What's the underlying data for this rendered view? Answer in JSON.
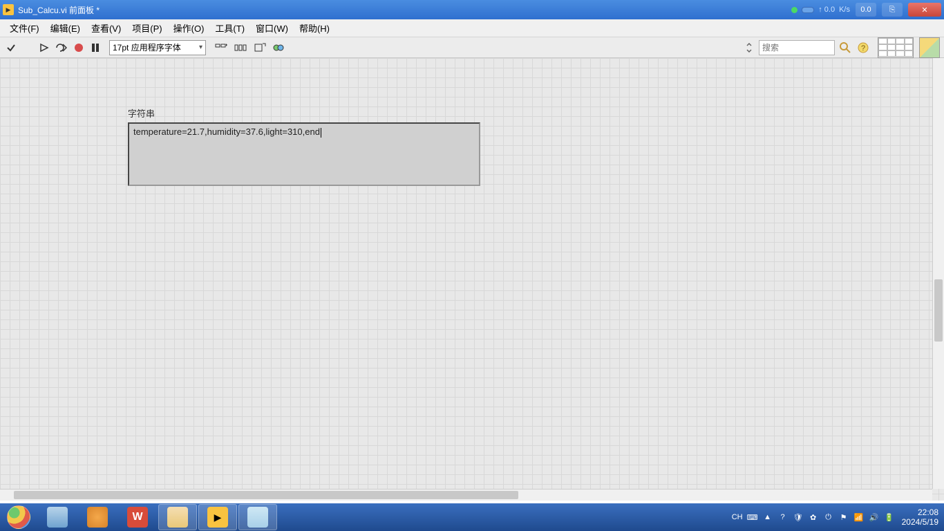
{
  "titlebar": {
    "title": "Sub_Calcu.vi 前面板 *",
    "net_up": "↑ 0.0",
    "net_unit": "K/s",
    "net_mem": "0.0"
  },
  "menubar": {
    "items": [
      "文件(F)",
      "编辑(E)",
      "查看(V)",
      "项目(P)",
      "操作(O)",
      "工具(T)",
      "窗口(W)",
      "帮助(H)"
    ]
  },
  "toolbar": {
    "font_label": "17pt 应用程序字体",
    "search_placeholder": "搜索"
  },
  "canvas": {
    "string_label": "字符串",
    "string_value": "temperature=21.7,humidity=37.6,light=310,end"
  },
  "taskbar": {
    "ime": "CH",
    "time": "22:08",
    "date": "2024/5/19"
  }
}
